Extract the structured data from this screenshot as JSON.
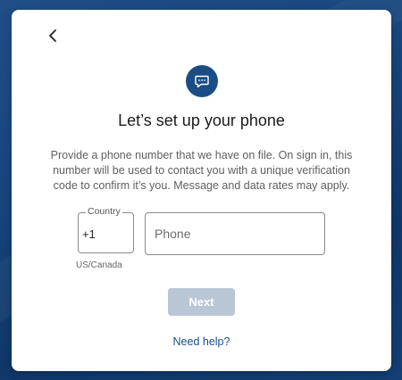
{
  "background": {
    "color": "#17467e"
  },
  "header": {
    "back_icon": "chevron-left-icon"
  },
  "hero": {
    "icon": "message-icon",
    "color": "#1a4d85"
  },
  "title": "Let’s set up your phone",
  "description": "Provide a phone number that we have on file. On sign in, this number will be used to contact you with a unique verification code to confirm it’s you. Message and data rates may apply.",
  "country": {
    "label": "Country",
    "code": "+1",
    "region": "US/Canada"
  },
  "phone": {
    "placeholder": "Phone",
    "value": ""
  },
  "actions": {
    "next_label": "Next",
    "next_color": "#b9c6d3",
    "help_label": "Need help?",
    "help_color": "#1a4d85"
  }
}
